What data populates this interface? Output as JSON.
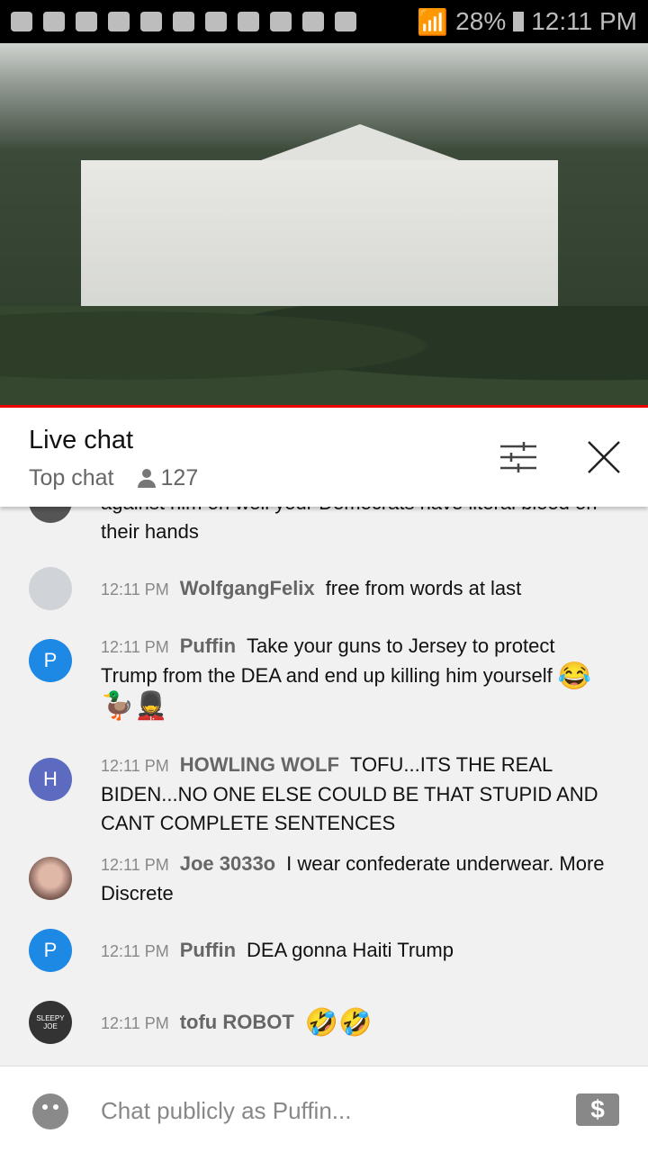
{
  "status_bar": {
    "battery": "28%",
    "time": "12:11 PM"
  },
  "header": {
    "title": "Live chat",
    "mode": "Top chat",
    "viewers": "127"
  },
  "messages": [
    {
      "time": "",
      "author": "",
      "text": "against him oh well your Democrats have literal blood on their hands",
      "avatar": "",
      "color": "#555"
    },
    {
      "time": "12:11 PM",
      "author": "WolfgangFelix",
      "text": "free from words at last",
      "avatar": "",
      "color": "#d0d4d8"
    },
    {
      "time": "12:11 PM",
      "author": "Puffin",
      "text": "Take your guns to Jersey to protect Trump from the DEA and end up killing him yourself",
      "emoji": "😂🦆💂",
      "avatar": "P",
      "color": "#1e88e5"
    },
    {
      "time": "12:11 PM",
      "author": "HOWLING WOLF",
      "text": "TOFU...ITS THE REAL BIDEN...NO ONE ELSE COULD BE THAT STUPID AND CANT COMPLETE SENTENCES",
      "avatar": "H",
      "color": "#5c6bc0"
    },
    {
      "time": "12:11 PM",
      "author": "Joe 3033o",
      "text": "I wear confederate underwear. More Discrete",
      "avatar": "",
      "color": "#a07060"
    },
    {
      "time": "12:11 PM",
      "author": "Puffin",
      "text": "DEA gonna Haiti Trump",
      "avatar": "P",
      "color": "#1e88e5"
    },
    {
      "time": "12:11 PM",
      "author": "tofu ROBOT",
      "text": "",
      "emoji": "🤣🤣",
      "avatar": "SLEEPY JOE",
      "color": "#333"
    }
  ],
  "input": {
    "placeholder": "Chat publicly as Puffin...",
    "super_chat_icon": "$"
  }
}
